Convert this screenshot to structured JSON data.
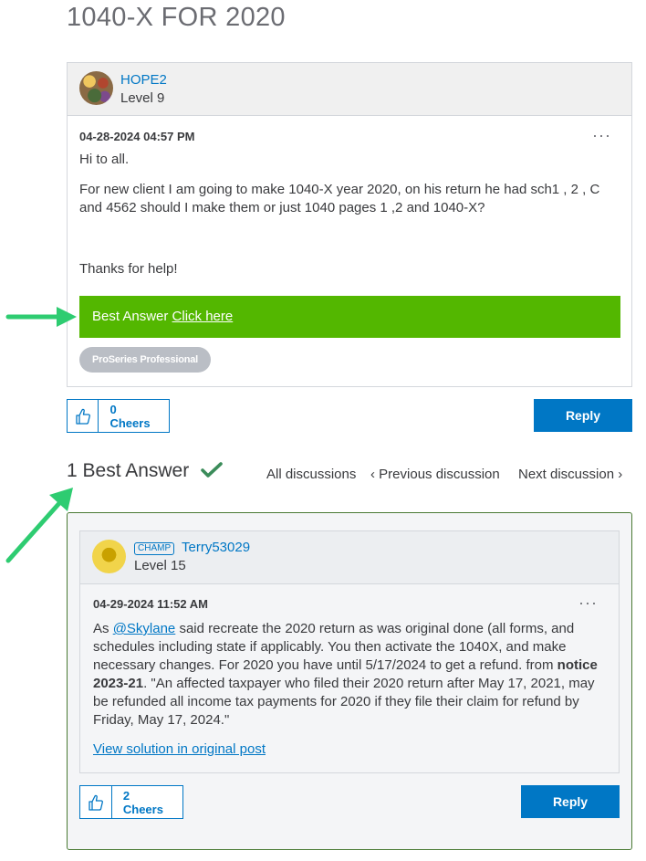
{
  "page": {
    "title": "1040-X FOR 2020"
  },
  "post": {
    "author": "HOPE2",
    "level": "Level 9",
    "date": "04-28-2024 04:57 PM",
    "greeting": "Hi to all.",
    "body": "For new client I am going to make 1040-X year 2020, on his return he had sch1 , 2 , C and 4562 should I make them or just 1040 pages 1 ,2 and 1040-X?",
    "thanks": "Thanks for help!",
    "more_label": "···",
    "best_answer_prefix": "Best Answer",
    "best_answer_link": "Click here",
    "tag": "ProSeries Professional",
    "cheers": "0 Cheers",
    "reply": "Reply"
  },
  "best_answers": {
    "heading": "1 Best Answer",
    "nav": {
      "all": "All discussions",
      "prev": "Previous discussion",
      "next": "Next discussion",
      "prev_chevron": "‹",
      "next_chevron": "›"
    }
  },
  "solution": {
    "badge": "CHAMP",
    "author": "Terry53029",
    "level": "Level 15",
    "date": "04-29-2024 11:52 AM",
    "more_label": "···",
    "body_as": "As ",
    "mention": "@Skylane",
    "body_1": " said recreate the 2020 return as was original done (all forms, and schedules including state if applicably. You then activate the 1040X, and make necessary changes. For 2020 you have until 5/17/2024 to get a refund. from ",
    "notice_bold": "notice 2023-21",
    "body_2": ".   \"An affected taxpayer who filed their 2020 return after May 17, 2021, may be refunded all income tax payments for 2020 if they file their claim for refund by Friday, May 17, 2024.\"",
    "view_link": "View solution in original post",
    "cheers": "2 Cheers",
    "reply": "Reply"
  },
  "colors": {
    "accent_blue": "#0077c5",
    "best_answer_green": "#53b700",
    "arrow_green": "#2ecc71",
    "check_green": "#3b8c5a"
  }
}
